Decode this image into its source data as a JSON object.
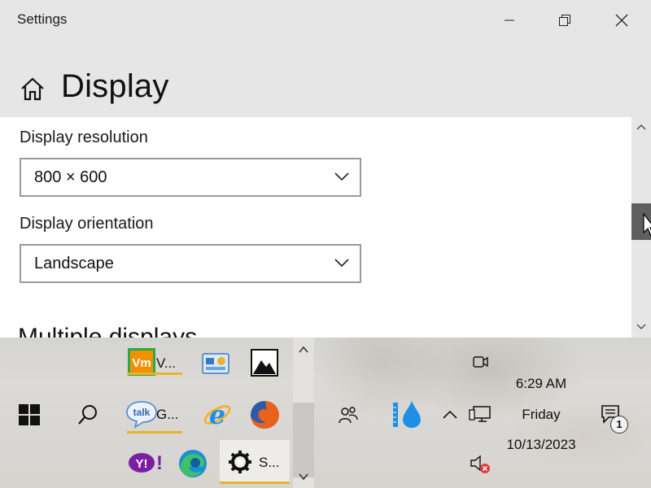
{
  "window": {
    "app_title": "Settings",
    "page_title": "Display"
  },
  "settings": {
    "resolution_label": "Display resolution",
    "resolution_value": "800 × 600",
    "orientation_label": "Display orientation",
    "orientation_value": "Landscape",
    "multiple_displays_heading": "Multiple displays"
  },
  "taskbar": {
    "apps": [
      {
        "name": "vmware",
        "label": "V..."
      },
      {
        "name": "control-panel",
        "label": ""
      },
      {
        "name": "photos",
        "label": ""
      },
      {
        "name": "google-talk",
        "label": "G..."
      },
      {
        "name": "internet-explorer",
        "label": ""
      },
      {
        "name": "firefox",
        "label": ""
      },
      {
        "name": "yahoo",
        "label": ""
      },
      {
        "name": "edge",
        "label": ""
      },
      {
        "name": "settings",
        "label": "S..."
      }
    ],
    "clock": {
      "time": "6:29 AM",
      "day": "Friday",
      "date": "10/13/2023"
    },
    "notification_count": "1"
  },
  "colors": {
    "accent_underline": "#e8b32d",
    "scroll_thumb": "#5f5f5f",
    "window_bg": "#e6e6e6"
  }
}
